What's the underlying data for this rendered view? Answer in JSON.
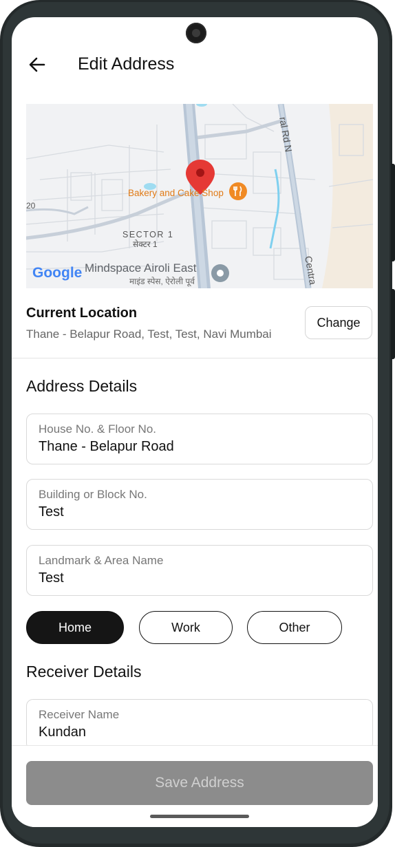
{
  "header": {
    "title": "Edit Address"
  },
  "map": {
    "poi_label": "Bakery and Cake Shop",
    "area_label": "SECTOR 1",
    "area_label_local": "सेक्टर 1",
    "place_label": "Mindspace Airoli East",
    "place_label_local": "माइंड स्पेस, ऐरोली पूर्व",
    "road_label_1": "ral Rd N",
    "road_label_2": "Centra",
    "edge_label": "20",
    "google_logo": "Google"
  },
  "location": {
    "title": "Current Location",
    "address": "Thane - Belapur Road, Test, Test, Navi Mumbai",
    "change_label": "Change"
  },
  "address_details": {
    "title": "Address Details",
    "fields": [
      {
        "label": "House No. & Floor No.",
        "value": "Thane - Belapur Road"
      },
      {
        "label": "Building or Block No.",
        "value": "Test"
      },
      {
        "label": "Landmark & Area Name",
        "value": "Test"
      }
    ],
    "types": [
      {
        "label": "Home",
        "selected": true
      },
      {
        "label": "Work",
        "selected": false
      },
      {
        "label": "Other",
        "selected": false
      }
    ]
  },
  "receiver_details": {
    "title": "Receiver Details",
    "name_label": "Receiver Name",
    "name_value": "Kundan"
  },
  "footer": {
    "save_label": "Save Address"
  },
  "colors": {
    "pin": "#e53935",
    "poi": "#f08a24",
    "active_chip": "#151515",
    "save_disabled": "#8c8c8c"
  }
}
